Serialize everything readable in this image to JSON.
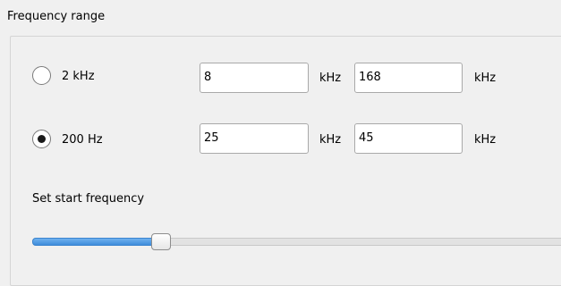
{
  "frequency_range": {
    "title": "Frequency range",
    "options": [
      {
        "label": "2 kHz",
        "selected": false,
        "start_value": "8",
        "start_unit": "kHz",
        "end_value": "168",
        "end_unit": "kHz"
      },
      {
        "label": "200 Hz",
        "selected": true,
        "start_value": "25",
        "start_unit": "kHz",
        "end_value": "45",
        "end_unit": "kHz"
      }
    ],
    "slider": {
      "label": "Set start frequency",
      "level_percent": 24
    }
  },
  "colors": {
    "slider_fill": "#3e8ddb",
    "background": "#f0f0f0"
  }
}
